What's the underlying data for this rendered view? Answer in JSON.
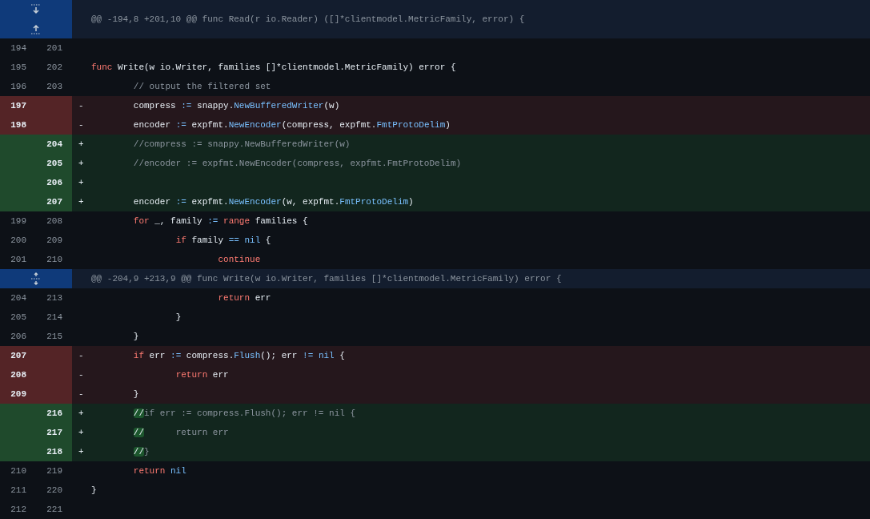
{
  "diff": [
    {
      "kind": "hunk",
      "expanders": [
        {
          "kind": "down"
        },
        {
          "kind": "up"
        }
      ],
      "header": "@@ -194,8 +201,10 @@ func Read(r io.Reader) ([]*clientmodel.MetricFamily, error) {"
    },
    {
      "kind": "context",
      "old": "194",
      "new": "201"
    },
    {
      "kind": "context",
      "old": "195",
      "new": "202",
      "tokens": [
        {
          "kind": "kw",
          "text": "func"
        },
        {
          "kind": "plain",
          "text": " Write(w io.Writer, families []*clientmodel.MetricFamily) error {"
        }
      ]
    },
    {
      "kind": "context",
      "old": "196",
      "new": "203",
      "tokens": [
        {
          "kind": "cm",
          "text": "\t// output the filtered set"
        }
      ]
    },
    {
      "kind": "deletion",
      "old": "197",
      "marker": "-",
      "tokens": [
        {
          "kind": "plain",
          "text": "\tcompress "
        },
        {
          "kind": "op",
          "text": ":="
        },
        {
          "kind": "plain",
          "text": " snappy."
        },
        {
          "kind": "op",
          "text": "NewBufferedWriter"
        },
        {
          "kind": "plain",
          "text": "(w)"
        }
      ]
    },
    {
      "kind": "deletion",
      "old": "198",
      "marker": "-",
      "tokens": [
        {
          "kind": "plain",
          "text": "\tencoder "
        },
        {
          "kind": "op",
          "text": ":="
        },
        {
          "kind": "plain",
          "text": " expfmt."
        },
        {
          "kind": "op",
          "text": "NewEncoder"
        },
        {
          "kind": "plain",
          "text": "(compress, expfmt."
        },
        {
          "kind": "op",
          "text": "FmtProtoDelim"
        },
        {
          "kind": "plain",
          "text": ")"
        }
      ]
    },
    {
      "kind": "addition",
      "new": "204",
      "marker": "+",
      "tokens": [
        {
          "kind": "cm",
          "text": "\t//compress := snappy.NewBufferedWriter(w)"
        }
      ]
    },
    {
      "kind": "addition",
      "new": "205",
      "marker": "+",
      "tokens": [
        {
          "kind": "cm",
          "text": "\t//encoder := expfmt.NewEncoder(compress, expfmt.FmtProtoDelim)"
        }
      ]
    },
    {
      "kind": "addition",
      "new": "206",
      "marker": "+"
    },
    {
      "kind": "addition",
      "new": "207",
      "marker": "+",
      "tokens": [
        {
          "kind": "plain",
          "text": "\tencoder "
        },
        {
          "kind": "op",
          "text": ":="
        },
        {
          "kind": "plain",
          "text": " expfmt."
        },
        {
          "kind": "op",
          "text": "NewEncoder"
        },
        {
          "kind": "plain",
          "text": "(w, expfmt."
        },
        {
          "kind": "op",
          "text": "FmtProtoDelim"
        },
        {
          "kind": "plain",
          "text": ")"
        }
      ]
    },
    {
      "kind": "context",
      "old": "199",
      "new": "208",
      "tokens": [
        {
          "kind": "kw",
          "text": "\tfor"
        },
        {
          "kind": "plain",
          "text": " _, family "
        },
        {
          "kind": "op",
          "text": ":="
        },
        {
          "kind": "kw",
          "text": " range"
        },
        {
          "kind": "plain",
          "text": " families {"
        }
      ]
    },
    {
      "kind": "context",
      "old": "200",
      "new": "209",
      "tokens": [
        {
          "kind": "kw",
          "text": "\t\tif"
        },
        {
          "kind": "plain",
          "text": " family "
        },
        {
          "kind": "op",
          "text": "=="
        },
        {
          "kind": "op",
          "text": " nil"
        },
        {
          "kind": "plain",
          "text": " {"
        }
      ]
    },
    {
      "kind": "context",
      "old": "201",
      "new": "210",
      "tokens": [
        {
          "kind": "kw",
          "text": "\t\t\tcontinue"
        }
      ]
    },
    {
      "kind": "hunk",
      "expanders": [
        {
          "kind": "both"
        }
      ],
      "header": "@@ -204,9 +213,9 @@ func Write(w io.Writer, families []*clientmodel.MetricFamily) error {"
    },
    {
      "kind": "context",
      "old": "204",
      "new": "213",
      "tokens": [
        {
          "kind": "kw",
          "text": "\t\t\treturn"
        },
        {
          "kind": "plain",
          "text": " err"
        }
      ]
    },
    {
      "kind": "context",
      "old": "205",
      "new": "214",
      "tokens": [
        {
          "kind": "plain",
          "text": "\t\t}"
        }
      ]
    },
    {
      "kind": "context",
      "old": "206",
      "new": "215",
      "tokens": [
        {
          "kind": "plain",
          "text": "\t}"
        }
      ]
    },
    {
      "kind": "deletion",
      "old": "207",
      "marker": "-",
      "tokens": [
        {
          "kind": "kw",
          "text": "\tif"
        },
        {
          "kind": "plain",
          "text": " err "
        },
        {
          "kind": "op",
          "text": ":="
        },
        {
          "kind": "plain",
          "text": " compress."
        },
        {
          "kind": "op",
          "text": "Flush"
        },
        {
          "kind": "plain",
          "text": "(); err "
        },
        {
          "kind": "op",
          "text": "!="
        },
        {
          "kind": "op",
          "text": " nil"
        },
        {
          "kind": "plain",
          "text": " {"
        }
      ]
    },
    {
      "kind": "deletion",
      "old": "208",
      "marker": "-",
      "tokens": [
        {
          "kind": "kw",
          "text": "\t\treturn"
        },
        {
          "kind": "plain",
          "text": " err"
        }
      ]
    },
    {
      "kind": "deletion",
      "old": "209",
      "marker": "-",
      "tokens": [
        {
          "kind": "plain",
          "text": "\t}"
        }
      ]
    },
    {
      "kind": "addition",
      "new": "216",
      "marker": "+",
      "tokens": [
        {
          "kind": "hl",
          "text": "\t//"
        },
        {
          "kind": "cm",
          "text": "if err := compress.Flush(); err != nil {"
        }
      ]
    },
    {
      "kind": "addition",
      "new": "217",
      "marker": "+",
      "tokens": [
        {
          "kind": "hl",
          "text": "\t//"
        },
        {
          "kind": "cm",
          "text": "\treturn err"
        }
      ]
    },
    {
      "kind": "addition",
      "new": "218",
      "marker": "+",
      "tokens": [
        {
          "kind": "hl",
          "text": "\t//"
        },
        {
          "kind": "cm",
          "text": "}"
        }
      ]
    },
    {
      "kind": "context",
      "old": "210",
      "new": "219",
      "tokens": [
        {
          "kind": "kw",
          "text": "\treturn"
        },
        {
          "kind": "op",
          "text": " nil"
        }
      ]
    },
    {
      "kind": "context",
      "old": "211",
      "new": "220",
      "tokens": [
        {
          "kind": "plain",
          "text": "}"
        }
      ]
    },
    {
      "kind": "context",
      "old": "212",
      "new": "221"
    }
  ]
}
